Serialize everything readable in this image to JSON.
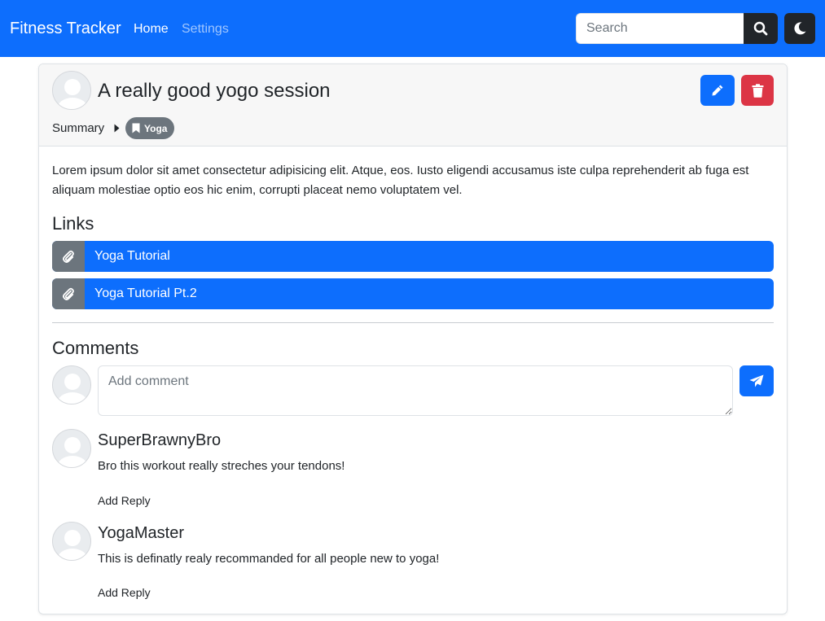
{
  "navbar": {
    "brand": "Fitness Tracker",
    "links": [
      "Home",
      "Settings"
    ],
    "search_placeholder": "Search",
    "search_icon": "search-icon",
    "theme_icon": "moon-icon",
    "background": "#0d6efd"
  },
  "post": {
    "title": "A really good yogo session",
    "breadcrumb": {
      "parent": "Summary",
      "tag": "Yoga"
    },
    "description": "Lorem ipsum dolor sit amet consectetur adipisicing elit. Atque, eos. Iusto eligendi accusamus iste culpa reprehenderit ab fuga est aliquam molestiae optio eos hic enim, corrupti placeat nemo voluptatem vel.",
    "actions": {
      "edit_icon": "pencil-icon",
      "delete_icon": "trash-icon"
    }
  },
  "links": {
    "heading": "Links",
    "items": [
      {
        "label": "Yoga Tutorial",
        "icon": "paperclip-icon"
      },
      {
        "label": "Yoga Tutorial Pt.2",
        "icon": "paperclip-icon"
      }
    ]
  },
  "comments": {
    "heading": "Comments",
    "input_placeholder": "Add comment",
    "send_icon": "paper-plane-icon",
    "items": [
      {
        "author": "SuperBrawnyBro",
        "text": "Bro this workout really streches your tendons!",
        "reply_label": "Add Reply"
      },
      {
        "author": "YogaMaster",
        "text": "This is definatly realy recommanded for all people new to yoga!",
        "reply_label": "Add Reply"
      }
    ]
  },
  "colors": {
    "primary": "#0d6efd",
    "danger": "#dc3545",
    "secondary": "#6c757d",
    "dark": "#212529"
  }
}
